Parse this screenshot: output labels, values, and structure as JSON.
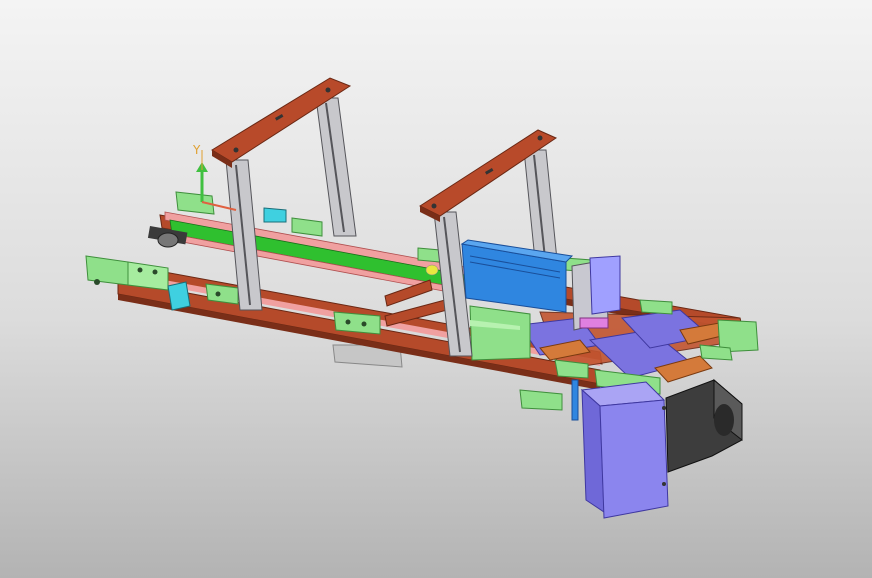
{
  "viewport": {
    "background_top": "#f4f4f4",
    "background_bottom": "#b3b3b3"
  },
  "triad": {
    "y_label": "Y",
    "x_color": "#e06040",
    "y_color": "#40c040"
  },
  "colors": {
    "frame_rail": "#b54a2a",
    "frame_rail_dark": "#7a2e18",
    "crossbar": "#b84a2a",
    "column": "#c8c8cc",
    "column_slot": "#55555a",
    "bracket": "#8fe08a",
    "bracket_dark": "#3f8f3c",
    "belt": "#2fc02f",
    "belt_rail": "#f0a0a0",
    "connector": "#2f86e0",
    "connector_dark": "#1a4f9a",
    "plate": "#7b73e0",
    "plate_dark": "#3f38a0",
    "cover": "#8b85ee",
    "motor": "#4a4a4a",
    "block_orange": "#d47a3a",
    "cyan": "#3fd0e0",
    "base_plate": "#c8c8c8"
  }
}
